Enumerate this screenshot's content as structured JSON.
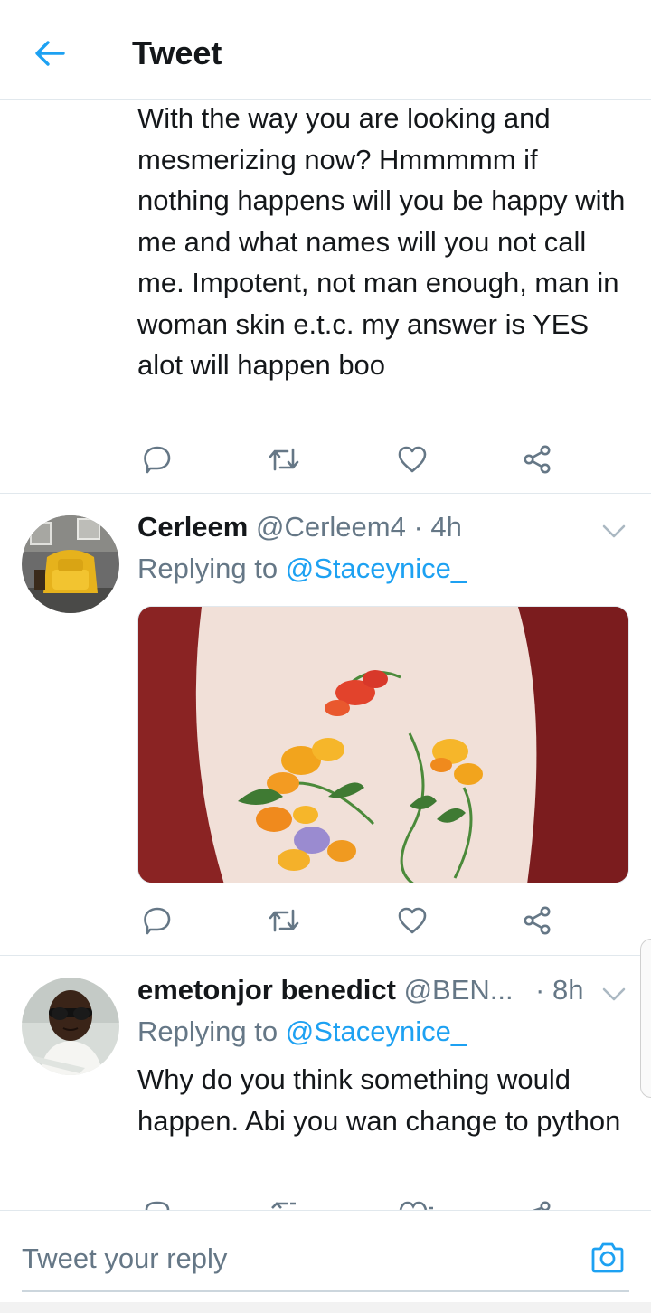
{
  "header": {
    "title": "Tweet"
  },
  "tweet1": {
    "text": "With the way you are looking and mesmerizing now? Hmmmmm if nothing happens will you be happy with me and what names will you not call me. Impotent, not man enough, man in woman skin e.t.c. my answer is YES alot will happen boo"
  },
  "tweet2": {
    "name": "Cerleem",
    "handle": "@Cerleem4",
    "sep": "·",
    "time": "4h",
    "replying_prefix": "Replying to",
    "replying_to": "@Staceynice_"
  },
  "tweet3": {
    "name": "emetonjor benedict",
    "handle": "@BEN...",
    "sep": "·",
    "time": "8h",
    "replying_prefix": "Replying to",
    "replying_to": "@Staceynice_",
    "text": "Why do you think something would happen. Abi you wan change to python"
  },
  "composer": {
    "placeholder": "Tweet your reply"
  },
  "colors": {
    "accent": "#1da1f2",
    "secondary_text": "#657786",
    "icon_gray": "#657786"
  },
  "icons": [
    "back-arrow-icon",
    "reply-icon",
    "retweet-icon",
    "like-icon",
    "share-icon",
    "chevron-down-icon",
    "camera-icon"
  ]
}
